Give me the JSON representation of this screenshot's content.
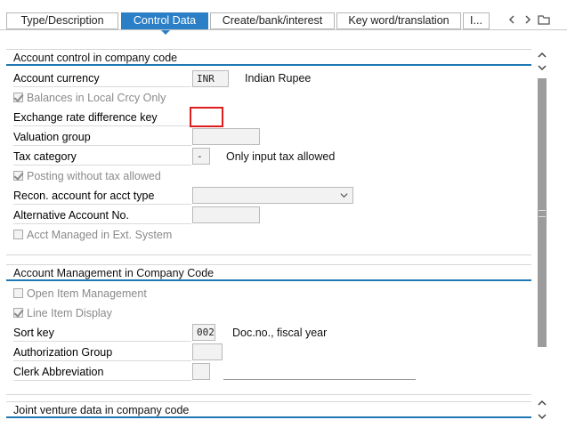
{
  "tabs": [
    {
      "label": "Type/Description",
      "active": false
    },
    {
      "label": "Control Data",
      "active": true
    },
    {
      "label": "Create/bank/interest",
      "active": false
    },
    {
      "label": "Key word/translation",
      "active": false
    },
    {
      "label": "I...",
      "active": false
    }
  ],
  "icons": {
    "tab_prev": "chevron-left-icon",
    "tab_next": "chevron-right-icon",
    "tab_list": "tab-list-icon",
    "scroll_up": "chevron-up-icon",
    "scroll_down": "chevron-down-icon",
    "dropdown": "chevron-down-icon"
  },
  "colors": {
    "accent": "#2a7fc6",
    "highlight_border": "#e01d1d"
  },
  "account_control": {
    "title": "Account control in company code",
    "account_currency_label": "Account currency",
    "account_currency_value": "INR",
    "account_currency_desc": "Indian Rupee",
    "balances_local_label": "Balances in Local Crcy Only",
    "balances_local_checked": true,
    "exchange_rate_label": "Exchange rate difference key",
    "exchange_rate_value": "",
    "valuation_group_label": "Valuation group",
    "valuation_group_value": "",
    "tax_category_label": "Tax category",
    "tax_category_value": "-",
    "tax_category_desc": "Only input tax allowed",
    "posting_wo_tax_label": "Posting without tax allowed",
    "posting_wo_tax_checked": true,
    "recon_label": "Recon. account for acct type",
    "recon_value": "",
    "alt_account_label": "Alternative Account No.",
    "alt_account_value": "",
    "ext_system_label": "Acct Managed in Ext. System",
    "ext_system_checked": false
  },
  "account_management": {
    "title": "Account Management in Company Code",
    "open_item_label": "Open Item Management",
    "open_item_checked": false,
    "line_item_label": "Line Item Display",
    "line_item_checked": true,
    "sort_key_label": "Sort key",
    "sort_key_value": "002",
    "sort_key_desc": "Doc.no., fiscal year",
    "auth_group_label": "Authorization Group",
    "auth_group_value": "",
    "clerk_label": "Clerk Abbreviation",
    "clerk_value": ""
  },
  "joint_venture": {
    "title": "Joint venture data in company code"
  }
}
